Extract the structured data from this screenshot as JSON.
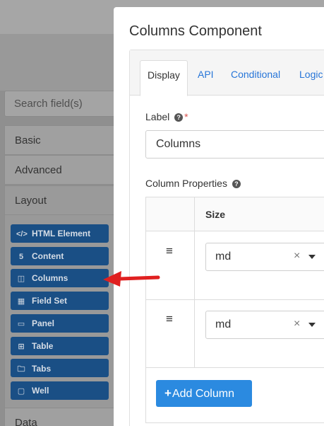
{
  "sidebar": {
    "search_placeholder": "Search field(s)",
    "groups": {
      "basic": "Basic",
      "advanced": "Advanced",
      "layout": "Layout",
      "data": "Data"
    },
    "layout_components": [
      {
        "label": "HTML Element",
        "icon": "code-icon",
        "glyph": "</>"
      },
      {
        "label": "Content",
        "icon": "html5-icon",
        "glyph": "5"
      },
      {
        "label": "Columns",
        "icon": "columns-icon",
        "glyph": "◫"
      },
      {
        "label": "Field Set",
        "icon": "th-large-icon",
        "glyph": "▦"
      },
      {
        "label": "Panel",
        "icon": "list-alt-icon",
        "glyph": "▭"
      },
      {
        "label": "Table",
        "icon": "table-icon",
        "glyph": "⊞"
      },
      {
        "label": "Tabs",
        "icon": "folder-icon",
        "glyph": "🗀"
      },
      {
        "label": "Well",
        "icon": "square-icon",
        "glyph": "▢"
      }
    ]
  },
  "modal": {
    "title": "Columns Component",
    "tabs": [
      "Display",
      "API",
      "Conditional",
      "Logic"
    ],
    "label_field": {
      "label": "Label",
      "required_mark": "*",
      "value": "Columns"
    },
    "column_properties": {
      "label": "Column Properties",
      "header_size": "Size",
      "rows": [
        {
          "size": "md"
        },
        {
          "size": "md"
        }
      ],
      "add_label": "Add Column"
    }
  },
  "colors": {
    "accent": "#2b8ae0",
    "sidebar_button": "#1a4f85",
    "arrow": "#e02020",
    "required": "#d9534f"
  }
}
